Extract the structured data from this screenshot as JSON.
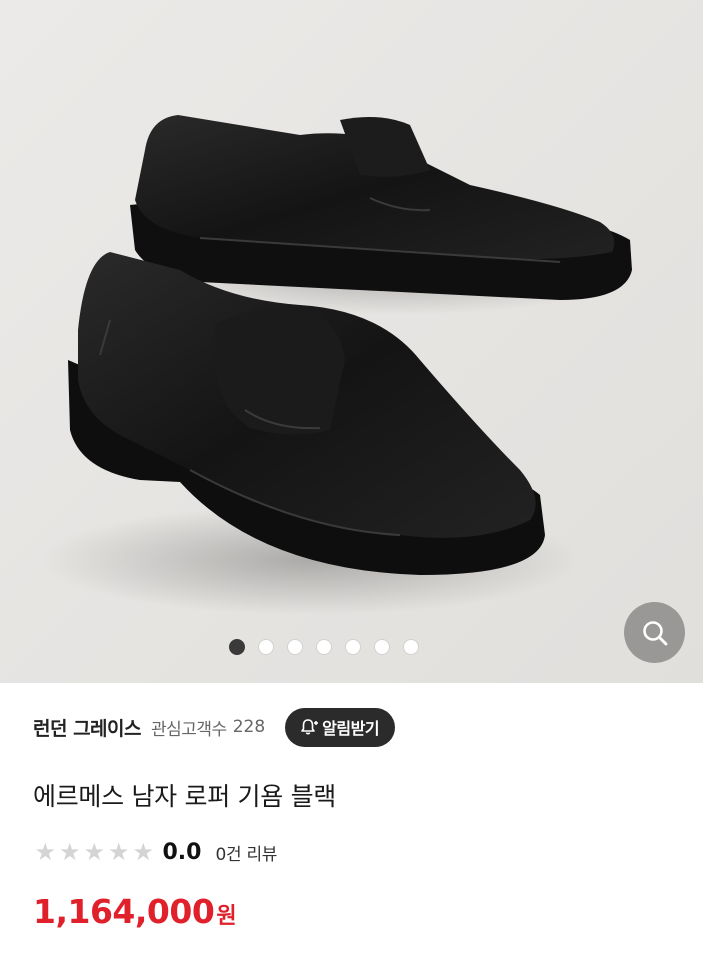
{
  "gallery": {
    "image_alt": "에르메스 남자 로퍼 기욤 블랙",
    "dot_count": 7,
    "active_index": 0,
    "zoom_icon": "search-icon"
  },
  "seller": {
    "name": "런던 그레이스",
    "watcher_label": "관심고객수",
    "watcher_count": "228",
    "alert_label": "알림받기",
    "alert_icon": "bell-plus-icon"
  },
  "product": {
    "title": "에르메스 남자 로퍼 기욤 블랙"
  },
  "rating": {
    "stars_filled": 0,
    "stars_total": 5,
    "value": "0.0",
    "review_text": "0건 리뷰"
  },
  "price": {
    "amount": "1,164,000",
    "unit": "원",
    "color": "#e0202a"
  },
  "colors": {
    "hero_bg": "#e7e5e3",
    "alert_bg": "#2b2b2b",
    "zoom_bg": "#9a9896"
  }
}
